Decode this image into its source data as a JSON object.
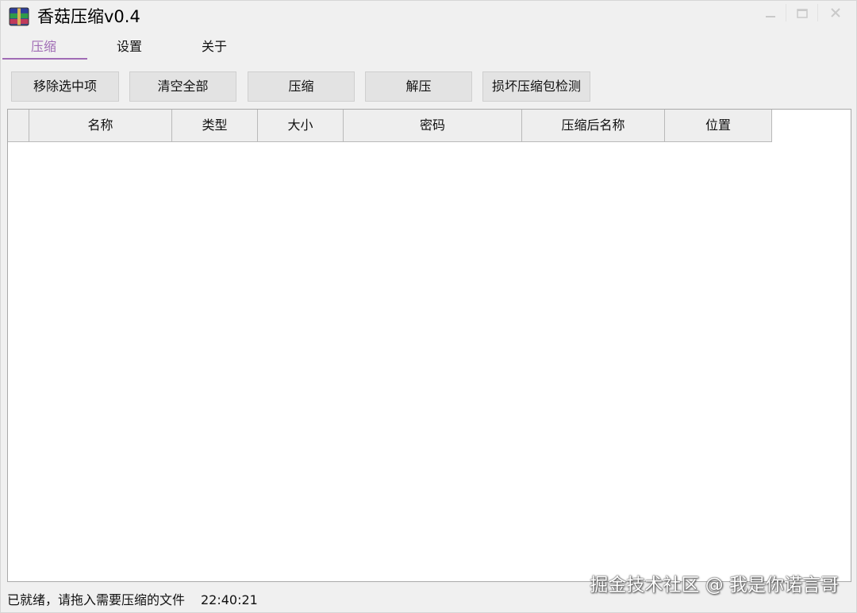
{
  "window": {
    "title": "香菇压缩v0.4"
  },
  "titlebar_buttons": {
    "minimize": "minimize",
    "maximize": "maximize",
    "close": "close"
  },
  "tabs": [
    {
      "label": "压缩",
      "active": true
    },
    {
      "label": "设置",
      "active": false
    },
    {
      "label": "关于",
      "active": false
    }
  ],
  "toolbar": {
    "remove_selected": "移除选中项",
    "clear_all": "清空全部",
    "compress": "压缩",
    "decompress": "解压",
    "damage_check": "损坏压缩包检测"
  },
  "table": {
    "columns": [
      "",
      "名称",
      "类型",
      "大小",
      "密码",
      "压缩后名称",
      "位置"
    ],
    "rows": []
  },
  "status": {
    "message": "已就绪，请拖入需要压缩的文件",
    "time": "22:40:21"
  },
  "watermark": "掘金技术社区 @ 我是你诺言哥",
  "colors": {
    "accent": "#a06cb5",
    "background": "#f0f0f0",
    "button": "#e3e3e3"
  }
}
